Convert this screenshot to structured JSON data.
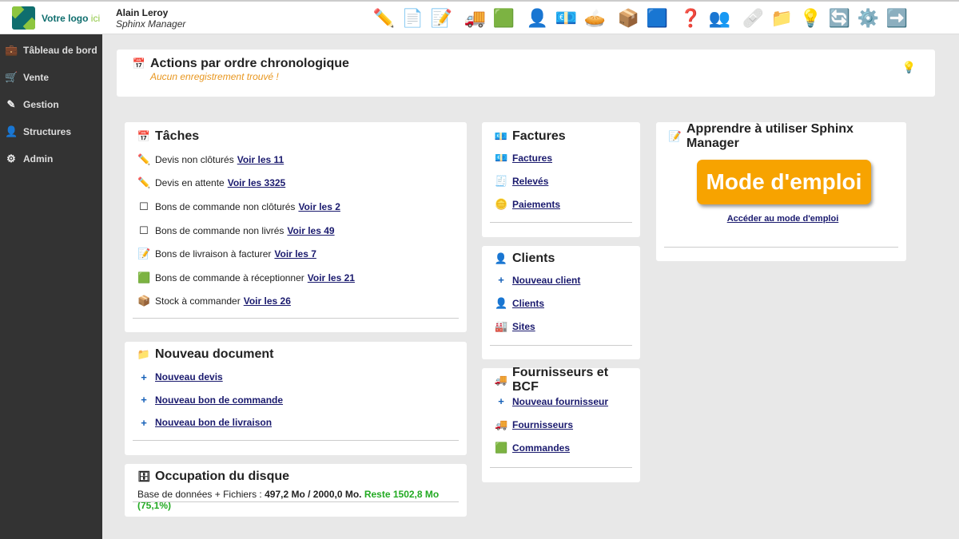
{
  "header": {
    "logo_text": "Votre logo",
    "logo_accent": "ici",
    "user_name": "Alain Leroy",
    "app_name": "Sphinx Manager",
    "toolbar": [
      {
        "icon": "pencil-icon",
        "g": "✏️"
      },
      {
        "icon": "blank-page-icon",
        "g": "📄"
      },
      {
        "icon": "edit-page-icon",
        "g": "📝"
      },
      {
        "icon": "truck-icon",
        "g": "🚚"
      },
      {
        "icon": "green-cube-icon",
        "g": "🟩"
      },
      {
        "icon": "user-icon",
        "g": "👤"
      },
      {
        "icon": "euro-icon",
        "g": "💶"
      },
      {
        "icon": "pie-chart-icon",
        "g": "🥧"
      },
      {
        "icon": "box-icon",
        "g": "📦"
      },
      {
        "icon": "blue-cubes-icon",
        "g": "🟦"
      },
      {
        "icon": "help-icon",
        "g": "❓"
      },
      {
        "icon": "org-users-icon",
        "g": "👥"
      },
      {
        "icon": "first-aid-icon",
        "g": "🩹"
      },
      {
        "icon": "folder-icon",
        "g": "📁"
      },
      {
        "icon": "lightbulb-icon",
        "g": "💡"
      },
      {
        "icon": "refresh-icon",
        "g": "🔄"
      },
      {
        "icon": "settings-icon",
        "g": "⚙️"
      },
      {
        "icon": "exit-icon",
        "g": "➡️"
      }
    ]
  },
  "sidebar": [
    {
      "label": "Tâbleau de bord",
      "icon": "briefcase-icon",
      "g": "💼"
    },
    {
      "label": "Vente",
      "icon": "cart-icon",
      "g": "🛒"
    },
    {
      "label": "Gestion",
      "icon": "pencil-icon",
      "g": "✎"
    },
    {
      "label": "Structures",
      "icon": "user-icon",
      "g": "👤"
    },
    {
      "label": "Admin",
      "icon": "gears-icon",
      "g": "⚙"
    }
  ],
  "actions": {
    "title": "Actions par ordre chronologique",
    "subtitle": "Aucun enregistrement trouvé !"
  },
  "taches": {
    "title": "Tâches",
    "items": [
      {
        "text": "Devis non clôturés",
        "link": "Voir les 11",
        "g": "✏️"
      },
      {
        "text": "Devis en attente",
        "link": "Voir les 3325",
        "g": "✏️"
      },
      {
        "text": "Bons de commande non clôturés",
        "link": "Voir les 2",
        "g": "☐"
      },
      {
        "text": "Bons de commande non livrés",
        "link": "Voir les 49",
        "g": "☐"
      },
      {
        "text": "Bons de livraison à facturer",
        "link": "Voir les 7",
        "g": "📝"
      },
      {
        "text": "Bons de commande à réceptionner",
        "link": "Voir les 21",
        "g": "🟩"
      },
      {
        "text": "Stock à commander",
        "link": "Voir les 26",
        "g": "📦"
      }
    ]
  },
  "nouveau": {
    "title": "Nouveau document",
    "items": [
      "Nouveau devis",
      "Nouveau bon de commande",
      "Nouveau bon de livraison"
    ]
  },
  "disque": {
    "title": "Occupation du disque",
    "label": "Base de données + Fichiers :",
    "used": "497,2 Mo / 2000,0 Mo.",
    "remaining": "Reste 1502,8 Mo (75,1%)"
  },
  "factures": {
    "title": "Factures",
    "items": [
      {
        "t": "Factures",
        "g": "💶"
      },
      {
        "t": "Relevés",
        "g": "🧾"
      },
      {
        "t": "Paiements",
        "g": "🪙"
      }
    ]
  },
  "clients": {
    "title": "Clients",
    "items": [
      {
        "t": "Nouveau client",
        "g": "+"
      },
      {
        "t": "Clients",
        "g": "👤"
      },
      {
        "t": "Sites",
        "g": "🏭"
      }
    ]
  },
  "fournisseurs": {
    "title": "Fournisseurs et BCF",
    "items": [
      {
        "t": "Nouveau fournisseur",
        "g": "+"
      },
      {
        "t": "Fournisseurs",
        "g": "🚚"
      },
      {
        "t": "Commandes",
        "g": "🟩"
      }
    ]
  },
  "apprendre": {
    "title": "Apprendre à utiliser Sphinx Manager",
    "button": "Mode d'emploi",
    "link": "Accéder au mode d'emploi"
  }
}
